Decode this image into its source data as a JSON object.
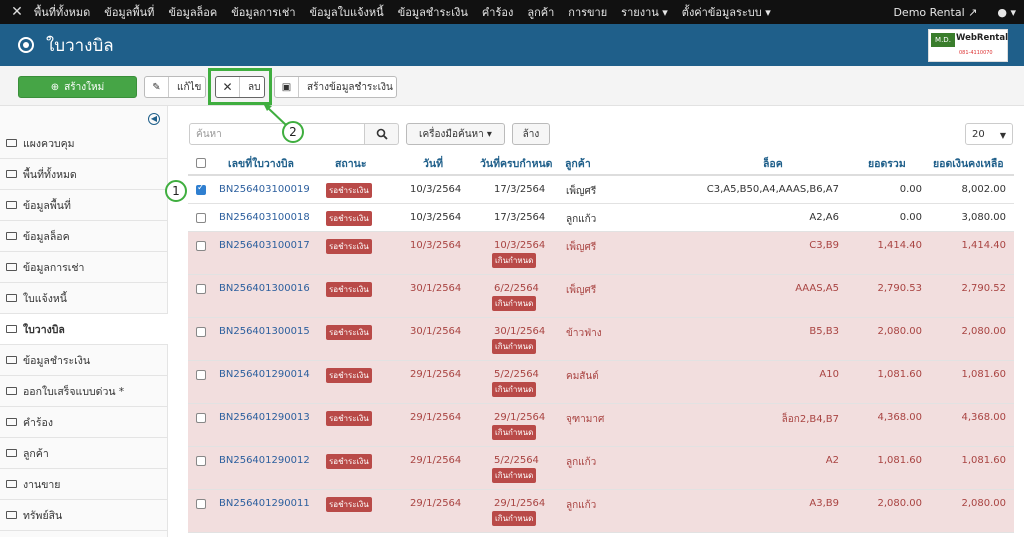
{
  "topnav": {
    "items": [
      "พื้นที่ทั้งหมด",
      "ข้อมูลพื้นที่",
      "ข้อมูลล็อค",
      "ข้อมูลการเช่า",
      "ข้อมูลใบแจ้งหนี้",
      "ข้อมูลชำระเงิน",
      "คำร้อง",
      "ลูกค้า",
      "การขาย",
      "รายงาน ▾",
      "ตั้งค่าข้อมูลระบบ ▾"
    ],
    "site": "Demo Rental",
    "user": "▾"
  },
  "page": {
    "title": "ใบวางบิล"
  },
  "logo": {
    "md": "M.D.",
    "brand": "WebRental",
    "sub": "081-4110070"
  },
  "toolbar": {
    "new": "สร้างใหม่",
    "edit": "แก้ไข",
    "delete": "ลบ",
    "payment": "สร้างข้อมูลชำระเงิน"
  },
  "callouts": {
    "one": "1",
    "two": "2"
  },
  "sidebar": {
    "items": [
      "แผงควบคุม",
      "พื้นที่ทั้งหมด",
      "ข้อมูลพื้นที่",
      "ข้อมูลล็อค",
      "ข้อมูลการเช่า",
      "ใบแจ้งหนี้",
      "ใบวางบิล",
      "ข้อมูลชำระเงิน",
      "ออกใบเสร็จแบบด่วน *",
      "คำร้อง",
      "ลูกค้า",
      "งานขาย",
      "ทรัพย์สิน"
    ],
    "active_index": 6
  },
  "filters": {
    "search_placeholder": "ค้นหา",
    "tools": "เครื่องมือค้นหา ▾",
    "clear": "ล้าง",
    "page_size": "20"
  },
  "table": {
    "headers": [
      "เลขที่ใบวางบิล",
      "สถานะ",
      "วันที่",
      "วันที่ครบกำหนด",
      "ลูกค้า",
      "ล็อค",
      "ยอดรวม",
      "ยอดเงินคงเหลือ"
    ],
    "rows": [
      {
        "doc": "BN256403100019",
        "status": "รอชำระเงิน",
        "date": "10/3/2564",
        "due": "17/3/2564",
        "overdue": "",
        "customer": "เพ็ญศรี",
        "lock": "C3,A5,B50,A4,AAAS,B6,A7",
        "total": "0.00",
        "balance": "8,002.00",
        "checked": true
      },
      {
        "doc": "BN256403100018",
        "status": "รอชำระเงิน",
        "date": "10/3/2564",
        "due": "17/3/2564",
        "overdue": "",
        "customer": "ลูกแก้ว",
        "lock": "A2,A6",
        "total": "0.00",
        "balance": "3,080.00",
        "checked": false
      },
      {
        "doc": "BN256403100017",
        "status": "รอชำระเงิน",
        "date": "10/3/2564",
        "due": "10/3/2564",
        "overdue": "เกินกำหนด",
        "customer": "เพ็ญศรี",
        "lock": "C3,B9",
        "total": "1,414.40",
        "balance": "1,414.40",
        "checked": false
      },
      {
        "doc": "BN256401300016",
        "status": "รอชำระเงิน",
        "date": "30/1/2564",
        "due": "6/2/2564",
        "overdue": "เกินกำหนด",
        "customer": "เพ็ญศรี",
        "lock": "AAAS,A5",
        "total": "2,790.53",
        "balance": "2,790.52",
        "checked": false
      },
      {
        "doc": "BN256401300015",
        "status": "รอชำระเงิน",
        "date": "30/1/2564",
        "due": "30/1/2564",
        "overdue": "เกินกำหนด",
        "customer": "ข้าวฟ่าง",
        "lock": "B5,B3",
        "total": "2,080.00",
        "balance": "2,080.00",
        "checked": false
      },
      {
        "doc": "BN256401290014",
        "status": "รอชำระเงิน",
        "date": "29/1/2564",
        "due": "5/2/2564",
        "overdue": "เกินกำหนด",
        "customer": "คมสันต์",
        "lock": "A10",
        "total": "1,081.60",
        "balance": "1,081.60",
        "checked": false
      },
      {
        "doc": "BN256401290013",
        "status": "รอชำระเงิน",
        "date": "29/1/2564",
        "due": "29/1/2564",
        "overdue": "เกินกำหนด",
        "customer": "จุฑามาศ",
        "lock": "ล็อก2,B4,B7",
        "total": "4,368.00",
        "balance": "4,368.00",
        "checked": false
      },
      {
        "doc": "BN256401290012",
        "status": "รอชำระเงิน",
        "date": "29/1/2564",
        "due": "5/2/2564",
        "overdue": "เกินกำหนด",
        "customer": "ลูกแก้ว",
        "lock": "A2",
        "total": "1,081.60",
        "balance": "1,081.60",
        "checked": false
      },
      {
        "doc": "BN256401290011",
        "status": "รอชำระเงิน",
        "date": "29/1/2564",
        "due": "29/1/2564",
        "overdue": "เกินกำหนด",
        "customer": "ลูกแก้ว",
        "lock": "A3,B9",
        "total": "2,080.00",
        "balance": "2,080.00",
        "checked": false
      }
    ]
  }
}
